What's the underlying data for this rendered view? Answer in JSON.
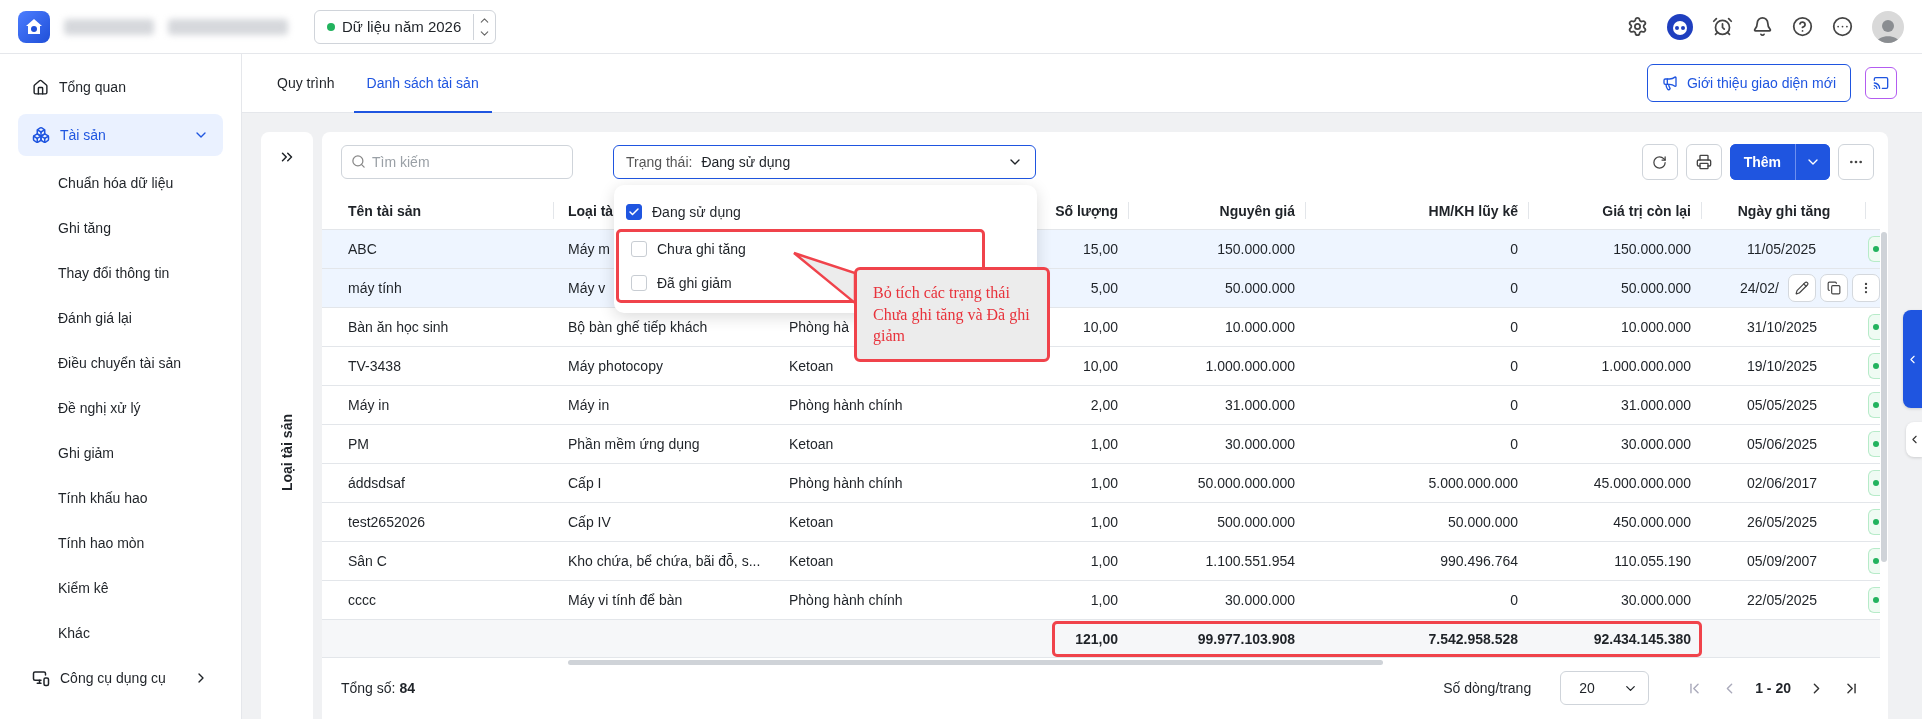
{
  "topbar": {
    "year_selector": {
      "label": "Dữ liệu năm 2026"
    }
  },
  "sidebar": {
    "items": [
      {
        "label": "Tổng quan",
        "kind": "home",
        "selected": false
      },
      {
        "label": "Tài sản",
        "kind": "assets",
        "selected": true,
        "expanded": true,
        "children": [
          {
            "label": "Chuẩn hóa dữ liệu",
            "selected": false
          },
          {
            "label": "Ghi tăng",
            "selected": false
          },
          {
            "label": "Thay đổi thông tin",
            "selected": false
          },
          {
            "label": "Đánh giá lại",
            "selected": false
          },
          {
            "label": "Điều chuyển tài sản",
            "selected": false
          },
          {
            "label": "Đề nghị xử lý",
            "selected": false
          },
          {
            "label": "Ghi giảm",
            "selected": false
          },
          {
            "label": "Tính khấu hao",
            "selected": false
          },
          {
            "label": "Tính hao mòn",
            "selected": false
          },
          {
            "label": "Kiểm kê",
            "selected": false
          },
          {
            "label": "Khác",
            "selected": false
          }
        ]
      },
      {
        "label": "Công cụ dụng cụ",
        "kind": "tools",
        "selected": false,
        "expanded": false
      }
    ]
  },
  "tabs": [
    {
      "label": "Quy trình",
      "selected": false
    },
    {
      "label": "Danh sách tài sản",
      "selected": true
    }
  ],
  "intro_button": "Giới thiệu giao diện mới",
  "side_panel": {
    "title": "Loại tài sản"
  },
  "toolbar": {
    "search": {
      "placeholder": "Tìm kiếm"
    },
    "status_filter": {
      "label": "Trạng thái:",
      "value": "Đang sử dụng",
      "expanded": true,
      "options": [
        {
          "label": "Đang sử dụng",
          "checked": true
        },
        {
          "label": "Chưa ghi tăng",
          "checked": false
        },
        {
          "label": "Đã ghi giảm",
          "checked": false
        }
      ]
    },
    "add_button": "Thêm"
  },
  "table": {
    "header": {
      "name": "Tên tài sản",
      "type": "Loại tà",
      "quantity": "Số lượng",
      "cost": "Nguyên giá",
      "depreciation": "HM/KH lũy kế",
      "remaining": "Giá trị còn lại",
      "date": "Ngày ghi tăng"
    },
    "rows": [
      {
        "name": "ABC",
        "type": "Máy m",
        "quantity": "15,00",
        "cost": "150.000.000",
        "depreciation": "0",
        "remaining": "150.000.000",
        "date": "11/05/2025",
        "selected": true,
        "hovered": false
      },
      {
        "name": "máy tính",
        "type": "Máy v",
        "quantity": "5,00",
        "cost": "50.000.000",
        "depreciation": "0",
        "remaining": "50.000.000",
        "date": "24/02/",
        "selected": true,
        "hovered": true
      },
      {
        "name": "Bàn ăn học sinh",
        "type": "Bộ bàn ghế tiếp khách",
        "column_3": "Phòng hà",
        "quantity": "10,00",
        "cost": "10.000.000",
        "depreciation": "0",
        "remaining": "10.000.000",
        "date": "31/10/2025",
        "selected": false,
        "hovered": false
      },
      {
        "name": "TV-3438",
        "type": "Máy photocopy",
        "column_3": "Ketoan",
        "quantity": "10,00",
        "cost": "1.000.000.000",
        "depreciation": "0",
        "remaining": "1.000.000.000",
        "date": "19/10/2025",
        "selected": false,
        "hovered": false
      },
      {
        "name": "Máy in",
        "type": "Máy in",
        "column_3": "Phòng hành chính",
        "quantity": "2,00",
        "cost": "31.000.000",
        "depreciation": "0",
        "remaining": "31.000.000",
        "date": "05/05/2025",
        "selected": false,
        "hovered": false
      },
      {
        "name": "PM",
        "type": "Phần mềm ứng dụng",
        "column_3": "Ketoan",
        "quantity": "1,00",
        "cost": "30.000.000",
        "depreciation": "0",
        "remaining": "30.000.000",
        "date": "05/06/2025",
        "selected": false,
        "hovered": false
      },
      {
        "name": "áddsdsaf",
        "type": "Cấp I",
        "column_3": "Phòng hành chính",
        "quantity": "1,00",
        "cost": "50.000.000.000",
        "depreciation": "5.000.000.000",
        "remaining": "45.000.000.000",
        "date": "02/06/2017",
        "selected": false,
        "hovered": false
      },
      {
        "name": "test2652026",
        "type": "Cấp IV",
        "column_3": "Ketoan",
        "quantity": "1,00",
        "cost": "500.000.000",
        "depreciation": "50.000.000",
        "remaining": "450.000.000",
        "date": "26/05/2025",
        "selected": false,
        "hovered": false
      },
      {
        "name": "Sân C",
        "type": "Kho chứa, bể chứa, bãi đỗ, s...",
        "column_3": "Ketoan",
        "quantity": "1,00",
        "cost": "1.100.551.954",
        "depreciation": "990.496.764",
        "remaining": "110.055.190",
        "date": "05/09/2007",
        "selected": false,
        "hovered": false
      },
      {
        "name": "cccc",
        "type": "Máy vi tính để bàn",
        "column_3": "Phòng hành chính",
        "quantity": "1,00",
        "cost": "30.000.000",
        "depreciation": "0",
        "remaining": "30.000.000",
        "date": "22/05/2025",
        "selected": false,
        "hovered": false
      }
    ],
    "totals": {
      "quantity": "121,00",
      "cost": "99.977.103.908",
      "depreciation": "7.542.958.528",
      "remaining": "92.434.145.380"
    }
  },
  "footer": {
    "total_label": "Tổng số:",
    "total_value": "84",
    "page_size_label": "Số dòng/trang",
    "page_size": "20",
    "page_range": "1 - 20"
  },
  "annotation": {
    "text": "Bỏ tích các trạng thái Chưa ghi tăng và Đã ghi giảm"
  }
}
